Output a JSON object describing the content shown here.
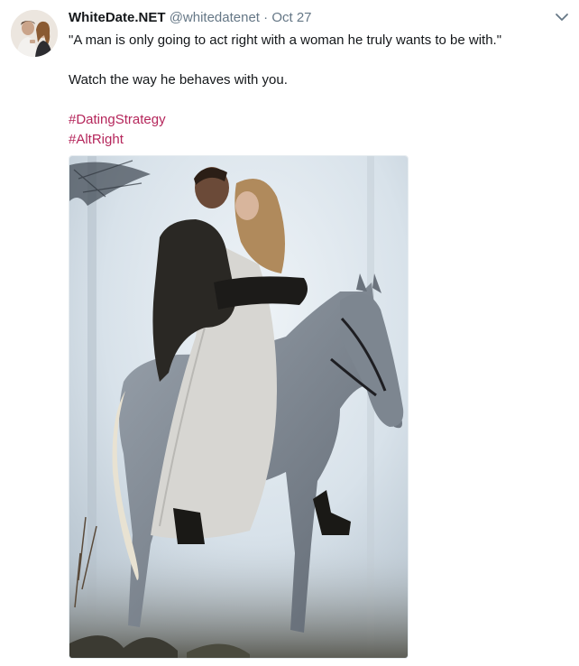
{
  "tweet": {
    "display_name": "WhiteDate.NET",
    "handle": "@whitedatenet",
    "separator": "·",
    "date": "Oct 27",
    "text_line_1": "\"A man is only going to act right with a woman he truly wants to be with.\"",
    "text_line_2": "Watch the way he behaves with you.",
    "hashtags": [
      "#DatingStrategy",
      "#AltRight"
    ]
  },
  "icons": {
    "avatar": "profile-photo",
    "more": "chevron-down-icon"
  },
  "colors": {
    "hashtag": "#b5265b",
    "secondary_text": "#657786",
    "primary_text": "#14171a"
  }
}
